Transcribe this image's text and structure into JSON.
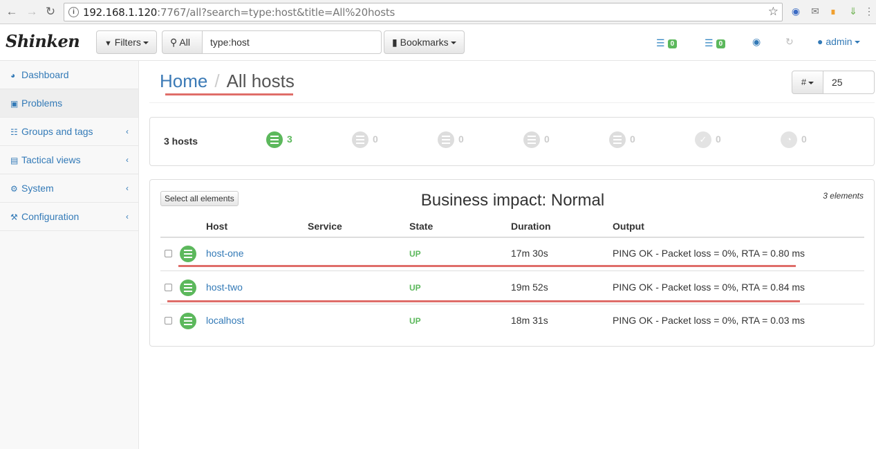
{
  "browser": {
    "url_host": "192.168.1.120",
    "url_rest": ":7767/all?search=type:host&title=All%20hosts"
  },
  "navbar": {
    "brand": "Shinken",
    "filters_label": "Filters",
    "search_scope_label": "All",
    "search_value": "type:host",
    "bookmarks_label": "Bookmarks",
    "hosts_problems_count": "0",
    "services_problems_count": "0",
    "user_label": "admin"
  },
  "sidebar": {
    "items": [
      {
        "label": "Dashboard"
      },
      {
        "label": "Problems"
      },
      {
        "label": "Groups and tags"
      },
      {
        "label": "Tactical views"
      },
      {
        "label": "System"
      },
      {
        "label": "Configuration"
      }
    ]
  },
  "breadcrumb": {
    "home": "Home",
    "separator": "/",
    "current": "All hosts"
  },
  "page_size": {
    "button_label": "#",
    "value": "25"
  },
  "summary": {
    "count_label": "3 hosts",
    "states": [
      {
        "value": "3"
      },
      {
        "value": "0"
      },
      {
        "value": "0"
      },
      {
        "value": "0"
      },
      {
        "value": "0"
      },
      {
        "value": "0"
      },
      {
        "value": "0"
      }
    ]
  },
  "table": {
    "select_all_label": "Select all elements",
    "title": "Business impact: Normal",
    "elements_count": "3 elements",
    "headers": {
      "host": "Host",
      "service": "Service",
      "state": "State",
      "duration": "Duration",
      "output": "Output"
    },
    "rows": [
      {
        "host": "host-one",
        "service": "",
        "state": "UP",
        "duration": "17m 30s",
        "output": "PING OK - Packet loss = 0%, RTA = 0.80 ms"
      },
      {
        "host": "host-two",
        "service": "",
        "state": "UP",
        "duration": "19m 52s",
        "output": "PING OK - Packet loss = 0%, RTA = 0.84 ms"
      },
      {
        "host": "localhost",
        "service": "",
        "state": "UP",
        "duration": "18m 31s",
        "output": "PING OK - Packet loss = 0%, RTA = 0.03 ms"
      }
    ]
  },
  "colors": {
    "ok_green": "#5cb85c",
    "link_blue": "#337ab7",
    "annotation_red": "#d9534f"
  }
}
